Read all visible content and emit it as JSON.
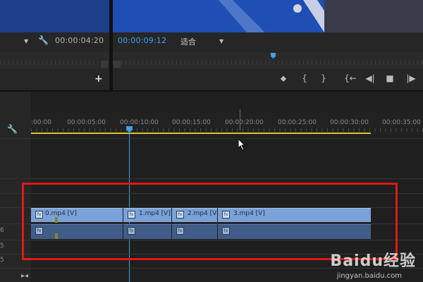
{
  "monitor": {
    "source_timecode": "00:00:04:20",
    "program_timecode": "00:00:09:12",
    "fit_label": "适合",
    "add_label": "+"
  },
  "controls": {
    "marker": "⬥",
    "in": "{",
    "out": "}",
    "go_in": "{←",
    "step_back": "◀|",
    "stop": "■",
    "play": "|▶"
  },
  "timeline": {
    "ruler_labels": [
      ":00:00",
      "00:00:05:00",
      "00:00:10:00",
      "00:00:15:00",
      "00:00:20:00",
      "00:00:25:00",
      "00:00:30:00",
      "00:00:35:00"
    ],
    "track_labels": [
      "6",
      "5",
      "5"
    ],
    "video_clips": [
      {
        "name": "0.mp4 [V]"
      },
      {
        "name": "1.mp4 [V]"
      },
      {
        "name": "2.mp4 [V]"
      },
      {
        "name": "3.mp4 [V]"
      }
    ]
  },
  "watermark": {
    "logo": "Baidu经验",
    "url": "jingyan.baidu.com"
  },
  "colors": {
    "accent": "#3ea2e8",
    "work_area": "#d8c62a",
    "clip_video": "#7aa2d8",
    "clip_audio": "#405c87",
    "highlight": "#e01818"
  }
}
